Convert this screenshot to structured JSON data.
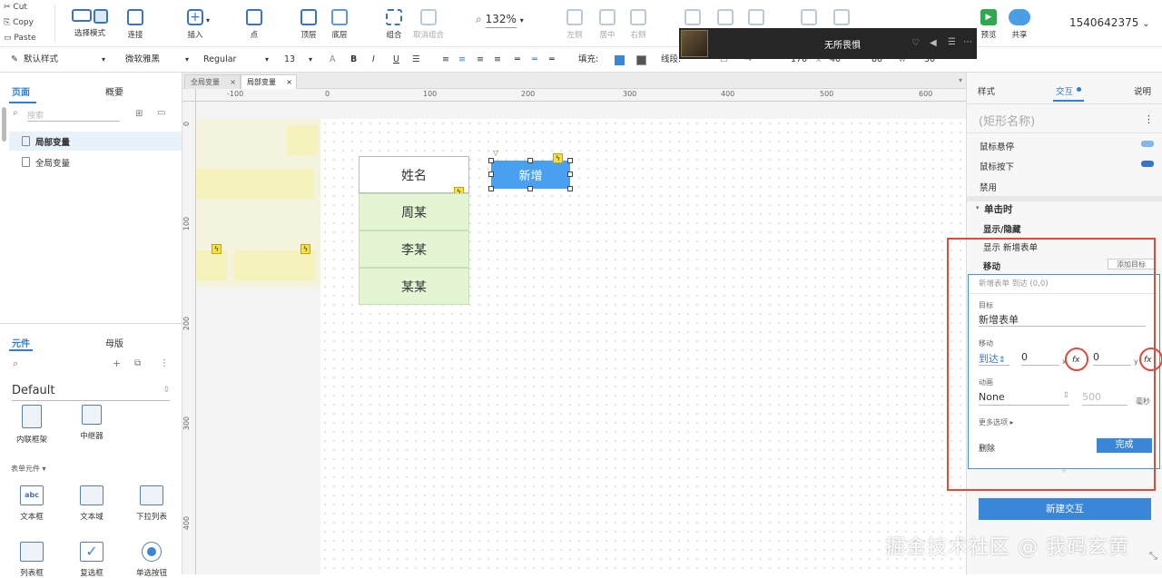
{
  "clipboard": {
    "cut": "Cut",
    "copy": "Copy",
    "paste": "Paste"
  },
  "toolbar": {
    "select_mode": "选择模式",
    "connect": "连接",
    "insert": "插入",
    "point": "点",
    "top_layer": "顶层",
    "bottom_layer": "底层",
    "group": "组合",
    "ungroup": "取消组合",
    "zoom": "132%",
    "align_left": "左侧",
    "align_center": "居中",
    "align_right": "右侧",
    "preview": "预览",
    "share": "共享",
    "account": "1540642375"
  },
  "format": {
    "style": "默认样式",
    "font": "微软雅黑",
    "weight": "Regular",
    "size": "13",
    "fill_label": "填充:",
    "line_label": "线段:",
    "x_val": "170",
    "x_label": "x",
    "y_val": "40",
    "w_val": "80",
    "w_label": "w",
    "h_val": "30"
  },
  "music": {
    "title": "无所畏惧"
  },
  "left": {
    "tabs": [
      "页面",
      "概要"
    ],
    "search_placeholder": "搜索",
    "pages": [
      "局部变量",
      "全局变量"
    ],
    "comp_tabs": [
      "元件",
      "母版"
    ],
    "library": "Default",
    "comps_top": [
      "内联框架",
      "中继器"
    ],
    "form_section": "表单元件 ▾",
    "comps_form": [
      "文本框",
      "文本域",
      "下拉列表",
      "列表框",
      "复选框",
      "单选按钮"
    ]
  },
  "doc_tabs": [
    "全局变量",
    "局部变量"
  ],
  "ruler_h": [
    "-100",
    "0",
    "100",
    "200",
    "300",
    "400",
    "500",
    "600"
  ],
  "ruler_v": [
    "0",
    "100",
    "200",
    "300",
    "400"
  ],
  "canvas": {
    "header": "姓名",
    "rows": [
      "周某",
      "李某",
      "某某"
    ],
    "button": "新增"
  },
  "right": {
    "tabs": [
      "样式",
      "交互",
      "说明"
    ],
    "name_placeholder": "(矩形名称)",
    "states": [
      "鼠标悬停",
      "鼠标按下",
      "禁用"
    ],
    "event": "单击时",
    "action1": "显示/隐藏",
    "action1_detail": "显示 新增表单",
    "action2": "移动",
    "add_target": "添加目标",
    "summary": "新增表单 到达 (0,0)",
    "target_label": "目标",
    "target_value": "新增表单",
    "move_label": "移动",
    "move_mode": "到达",
    "move_x": "0",
    "x_unit": "x",
    "move_y": "0",
    "y_unit": "y",
    "fx": "fx",
    "anim_label": "动画",
    "anim_value": "None",
    "anim_ms": "500",
    "ms_unit": "毫秒",
    "more": "更多选项 ▸",
    "delete": "删除",
    "done": "完成",
    "new_interaction": "新建交互"
  },
  "watermark": "掘金技术社区 @ 我码玄黄",
  "colors": {
    "accent": "#2c7fd6",
    "button": "#4aa0f0",
    "row_fill": "#e3f5d2",
    "highlight": "#e04a3a"
  }
}
